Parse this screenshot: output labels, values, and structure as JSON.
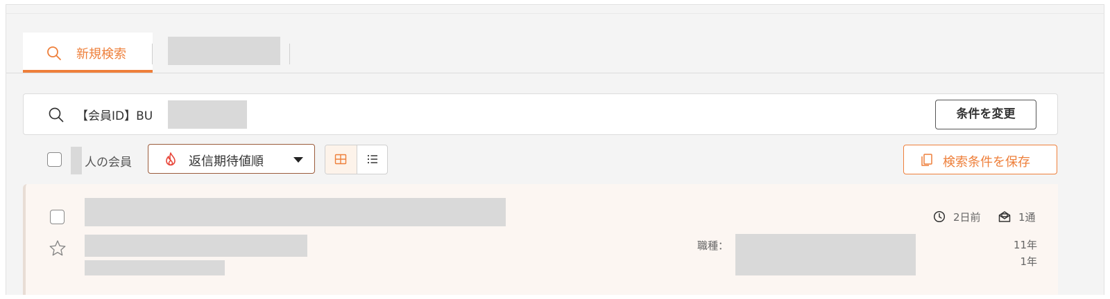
{
  "tabs": {
    "new_search": {
      "label": "新規検索",
      "icon": "search-icon"
    }
  },
  "search": {
    "query_text": "【会員ID】BU",
    "change_button": "条件を変更"
  },
  "toolbar": {
    "count_suffix": "人の会員",
    "sort_label": "返信期待値順",
    "save_button": "検索条件を保存"
  },
  "result": {
    "job_label": "職種：",
    "last_active": "2日前",
    "message_count": "1通",
    "experience_1": "11年",
    "experience_2": "1年"
  },
  "colors": {
    "accent": "#ee7f3a",
    "card_bg": "#fcf6f2",
    "redacted": "#d9d9d9"
  }
}
